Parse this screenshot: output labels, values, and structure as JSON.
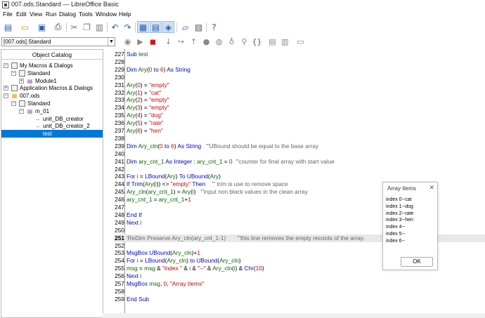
{
  "window": {
    "title": "007.ods.Standard — LibreOffice Basic"
  },
  "menu": [
    "File",
    "Edit",
    "View",
    "Run",
    "Dialog",
    "Tools",
    "Window",
    "Help"
  ],
  "library_selector": {
    "value": "[007.ods].Standard"
  },
  "catalog": {
    "header": "Object Catalog",
    "items": [
      {
        "label": "My Macros & Dialogs",
        "level": 0,
        "expander": "⊟",
        "icon": "lib"
      },
      {
        "label": "Standard",
        "level": 1,
        "expander": "⊟",
        "icon": "lib"
      },
      {
        "label": "Module1",
        "level": 2,
        "expander": "⊞",
        "icon": "mod"
      },
      {
        "label": "Application Macros & Dialogs",
        "level": 0,
        "expander": "⊞",
        "icon": "lib"
      },
      {
        "label": "007.ods",
        "level": 0,
        "expander": "⊟",
        "icon": "doc"
      },
      {
        "label": "Standard",
        "level": 1,
        "expander": "⊟",
        "icon": "lib"
      },
      {
        "label": "m_01",
        "level": 2,
        "expander": "⊟",
        "icon": "mod"
      },
      {
        "label": "unit_DB_creator",
        "level": 3,
        "expander": "",
        "icon": "proc"
      },
      {
        "label": "unit_DB_creator_2",
        "level": 3,
        "expander": "",
        "icon": "proc"
      },
      {
        "label": "test",
        "level": 3,
        "expander": "",
        "icon": "proc",
        "selected": true
      }
    ]
  },
  "editor": {
    "current_line": "251",
    "lines": [
      {
        "n": "227",
        "html": "<span class='kw'>Sub</span> <span class='ident'>test</span>"
      },
      {
        "n": "228",
        "html": ""
      },
      {
        "n": "229",
        "html": "<span class='kw'>Dim</span> <span class='ident'>Ary</span>(<span class='num'>0</span> <span class='kw'>to</span> <span class='num'>6</span>) <span class='kw'>As String</span>"
      },
      {
        "n": "230",
        "html": ""
      },
      {
        "n": "231",
        "html": "<span class='ident'>Ary</span>(<span class='num'>0</span>) = <span class='str'>\"empty\"</span>"
      },
      {
        "n": "232",
        "html": "<span class='ident'>Ary</span>(<span class='num'>1</span>) = <span class='str'>\"cat\"</span>"
      },
      {
        "n": "233",
        "html": "<span class='ident'>Ary</span>(<span class='num'>2</span>) = <span class='str'>\"empty\"</span>"
      },
      {
        "n": "234",
        "html": "<span class='ident'>Ary</span>(<span class='num'>3</span>) = <span class='str'>\"empty\"</span>"
      },
      {
        "n": "235",
        "html": "<span class='ident'>Ary</span>(<span class='num'>4</span>) = <span class='str'>\"dog\"</span>"
      },
      {
        "n": "236",
        "html": "<span class='ident'>Ary</span>(<span class='num'>5</span>) = <span class='str'>\"rate\"</span>"
      },
      {
        "n": "237",
        "html": "<span class='ident'>Ary</span>(<span class='num'>6</span>) = <span class='str'>\"hen\"</span>"
      },
      {
        "n": "238",
        "html": ""
      },
      {
        "n": "239",
        "html": "<span class='kw'>Dim</span> <span class='ident'>Ary_cln</span>(<span class='num'>0</span> <span class='kw'>to</span> <span class='num'>6</span>) <span class='kw'>As String</span>&nbsp;&nbsp;&nbsp;<span class='cmt'>'\"UBound should be equal to the base array</span>"
      },
      {
        "n": "240",
        "html": ""
      },
      {
        "n": "241",
        "html": "<span class='kw'>Dim</span> <span class='ident'>ary_cnt_1</span> <span class='kw'>As Integer</span> : <span class='ident'>ary_cnt_1</span> = <span class='num'>0</span>&nbsp;&nbsp;<span class='cmt'>'\"counter for final array with start value</span>"
      },
      {
        "n": "242",
        "html": ""
      },
      {
        "n": "243",
        "html": "<span class='kw'>For</span> <span class='ident'>i</span> = <span class='kw'>LBound</span>(<span class='ident'>Ary</span>) <span class='kw'>To</span> <span class='kw'>UBound</span>(<span class='ident'>Ary</span>)"
      },
      {
        "n": "244",
        "html": "<span class='kw'>If</span> <span class='kw'>Trim</span>(<span class='ident'>Ary</span>(<span class='ident'>i</span>)) &lt;&gt; <span class='str'>\"empty\"</span> <span class='kw'>Then</span>&nbsp;&nbsp;&nbsp;&nbsp;<span class='cmt'>'\" trim is use to remove space</span>"
      },
      {
        "n": "245",
        "html": "<span class='ident'>Ary_cln</span>(<span class='ident'>ary_cnt_1</span>) = <span class='ident'>Ary</span>(<span class='ident'>i</span>)&nbsp;&nbsp;&nbsp;<span class='cmt'>'\"input non black values in the clean array</span>"
      },
      {
        "n": "246",
        "html": "<span class='ident'>ary_cnt_1</span> = <span class='ident'>ary_cnt_1</span>+<span class='num'>1</span>"
      },
      {
        "n": "247",
        "html": ""
      },
      {
        "n": "248",
        "html": "<span class='kw'>End If</span>"
      },
      {
        "n": "249",
        "html": "<span class='kw'>Next</span> <span class='ident'>i</span>"
      },
      {
        "n": "250",
        "html": ""
      },
      {
        "n": "251",
        "html": "<span class='cmt'>'ReDim Preserve Ary_cln(ary_cnt_1-1)&nbsp;&nbsp;&nbsp;&nbsp;&nbsp;&nbsp;&nbsp;'\"this line removes the empty records of the array.</span>"
      },
      {
        "n": "252",
        "html": ""
      },
      {
        "n": "253",
        "html": "<span class='kw'>MsgBox</span> <span class='kw'>UBound</span>(<span class='ident'>Ary_cln</span>)+<span class='num'>1</span>"
      },
      {
        "n": "254",
        "html": "<span class='kw'>For</span> <span class='ident'>i</span> = <span class='kw'>LBound</span>(<span class='ident'>Ary_cln</span>) <span class='kw'>to</span> <span class='kw'>UBound</span>(<span class='ident'>Ary_cln</span>)"
      },
      {
        "n": "255",
        "html": "<span class='ident'>msg</span> = <span class='ident'>msg</span> &amp; <span class='str'>\"index \"</span> &amp; <span class='ident'>i</span> &amp; <span class='str'>\"--\"</span> &amp; <span class='ident'>Ary_cln</span>(<span class='ident'>i</span>) &amp; <span class='kw'>Chr</span>(<span class='num'>10</span>)"
      },
      {
        "n": "256",
        "html": "<span class='kw'>Next</span> <span class='ident'>i</span>"
      },
      {
        "n": "257",
        "html": "<span class='kw'>MsgBox</span> <span class='ident'>msg</span>, <span class='num'>0</span>, <span class='str'>\"Array Items\"</span>"
      },
      {
        "n": "258",
        "html": ""
      },
      {
        "n": "259",
        "html": "<span class='kw'>End Sub</span>"
      }
    ]
  },
  "dialog": {
    "title": "Array Items",
    "close": "✕",
    "lines": [
      "index 0--cat",
      "index 1--dog",
      "index 2--rate",
      "index 3--hen",
      "index 4--",
      "index 5--",
      "index 6--"
    ],
    "ok_label": "OK"
  },
  "colors": {
    "keyword": "#0000cc",
    "string": "#cc0000",
    "comment": "#666666",
    "identifier": "#006400",
    "selection": "#0078d7"
  }
}
